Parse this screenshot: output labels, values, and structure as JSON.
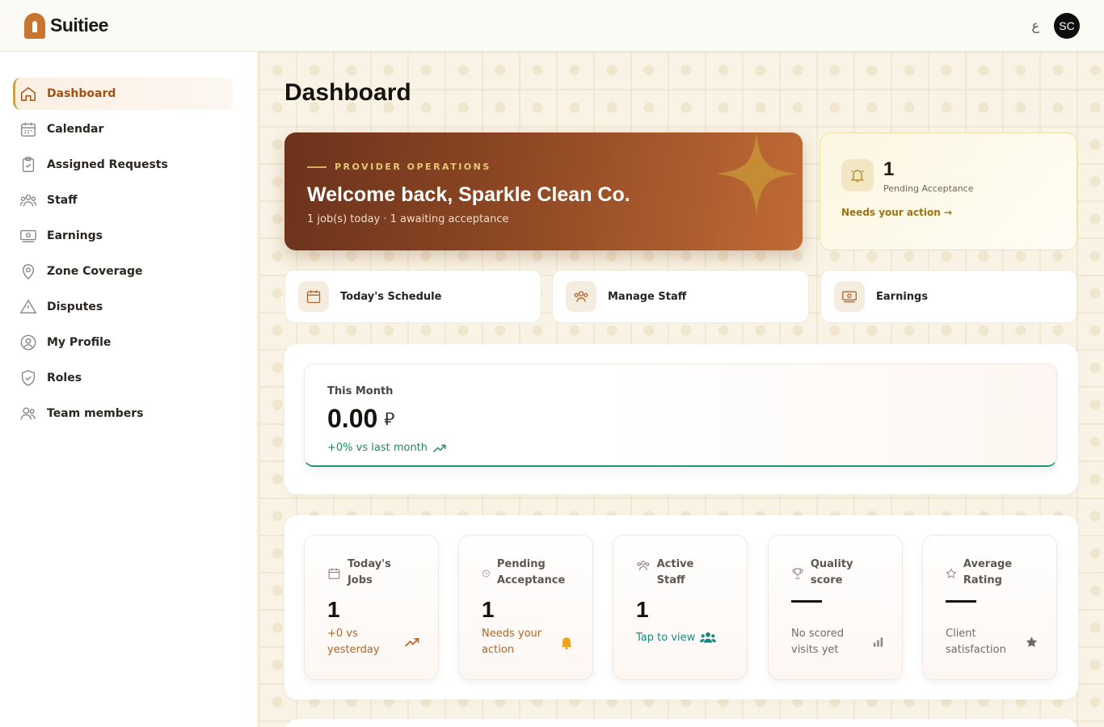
{
  "app": {
    "name": "Suitiee",
    "language_toggle": "ع",
    "user_initials": "SC"
  },
  "sidebar": {
    "items": [
      {
        "label": "Dashboard",
        "icon": "home-icon",
        "active": true
      },
      {
        "label": "Calendar",
        "icon": "calendar-icon"
      },
      {
        "label": "Assigned Requests",
        "icon": "clipboard-check-icon"
      },
      {
        "label": "Staff",
        "icon": "users-icon"
      },
      {
        "label": "Earnings",
        "icon": "banknote-icon"
      },
      {
        "label": "Zone Coverage",
        "icon": "map-pin-icon"
      },
      {
        "label": "Disputes",
        "icon": "warning-icon"
      },
      {
        "label": "My Profile",
        "icon": "user-circle-icon"
      },
      {
        "label": "Roles",
        "icon": "shield-check-icon"
      },
      {
        "label": "Team members",
        "icon": "team-icon"
      }
    ]
  },
  "page": {
    "title": "Dashboard"
  },
  "hero": {
    "eyebrow": "PROVIDER OPERATIONS",
    "title": "Welcome back, Sparkle Clean Co.",
    "subtitle": "1 job(s) today · 1 awaiting acceptance"
  },
  "pending": {
    "value": "1",
    "label": "Pending Acceptance",
    "link": "Needs your action →"
  },
  "quick_actions": [
    {
      "label": "Today's Schedule",
      "icon": "calendar-icon"
    },
    {
      "label": "Manage Staff",
      "icon": "users-icon"
    },
    {
      "label": "Earnings",
      "icon": "banknote-icon"
    }
  ],
  "month": {
    "label": "This Month",
    "value": "0.00",
    "currency": "⃁",
    "delta": "+0% vs last month"
  },
  "stats": [
    {
      "title": "Today's Jobs",
      "value": "1",
      "foot": "+0 vs yesterday",
      "icon": "calendar-icon",
      "foot_icon": "trending-up-icon"
    },
    {
      "title": "Pending Acceptance",
      "value": "1",
      "foot": "Needs your action",
      "icon": "clock-icon",
      "foot_icon": "bell-icon"
    },
    {
      "title": "Active Staff",
      "value": "1",
      "foot": "Tap to view",
      "icon": "users-icon",
      "foot_icon": "team-icon"
    },
    {
      "title": "Quality score",
      "value": "—",
      "foot": "No scored visits yet",
      "icon": "trophy-icon",
      "foot_icon": "bar-chart-icon"
    },
    {
      "title": "Average Rating",
      "value": "—",
      "foot": "Client satisfaction",
      "icon": "star-icon",
      "foot_icon": "star-filled-icon"
    }
  ],
  "colors": {
    "accent": "#a45114",
    "success": "#1f8a5c",
    "teal": "#168a82",
    "gold": "#9c7414"
  }
}
